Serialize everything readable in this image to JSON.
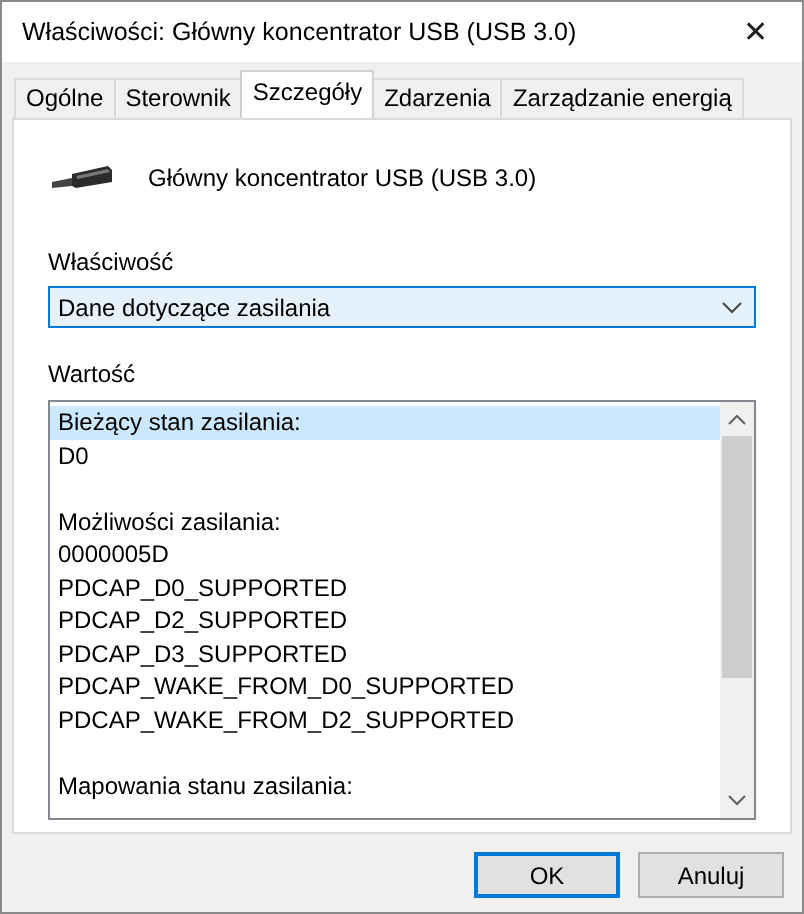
{
  "window": {
    "title": "Właściwości: Główny koncentrator USB (USB 3.0)",
    "close": "✕"
  },
  "tabs": [
    {
      "label": "Ogólne",
      "selected": false
    },
    {
      "label": "Sterownik",
      "selected": false
    },
    {
      "label": "Szczegóły",
      "selected": true
    },
    {
      "label": "Zdarzenia",
      "selected": false
    },
    {
      "label": "Zarządzanie energią",
      "selected": false
    }
  ],
  "device": {
    "name": "Główny koncentrator USB (USB 3.0)"
  },
  "property": {
    "label": "Właściwość",
    "value": "Dane dotyczące zasilania"
  },
  "value": {
    "label": "Wartość",
    "groups": [
      {
        "lines": [
          {
            "text": "Bieżący stan zasilania:",
            "selected": true
          },
          {
            "text": "D0",
            "selected": false
          }
        ]
      },
      {
        "lines": [
          {
            "text": "Możliwości zasilania:",
            "selected": false
          },
          {
            "text": "0000005D",
            "selected": false
          },
          {
            "text": "PDCAP_D0_SUPPORTED",
            "selected": false
          },
          {
            "text": "PDCAP_D2_SUPPORTED",
            "selected": false
          },
          {
            "text": "PDCAP_D3_SUPPORTED",
            "selected": false
          },
          {
            "text": "PDCAP_WAKE_FROM_D0_SUPPORTED",
            "selected": false
          },
          {
            "text": "PDCAP_WAKE_FROM_D2_SUPPORTED",
            "selected": false
          }
        ]
      },
      {
        "lines": [
          {
            "text": "Mapowania stanu zasilania:",
            "selected": false
          }
        ]
      }
    ]
  },
  "buttons": [
    {
      "label": "OK",
      "default": true
    },
    {
      "label": "Anuluj",
      "default": false
    }
  ]
}
